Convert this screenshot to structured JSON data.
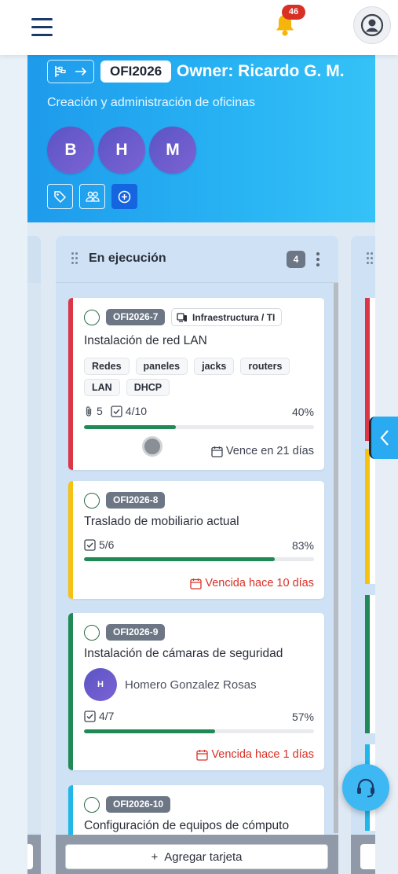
{
  "header": {
    "notification_count": "46"
  },
  "board": {
    "code": "OFI2026",
    "owner": "Owner: Ricardo G. M.",
    "subtitle": "Creación y administración de oficinas",
    "members": [
      "B",
      "H",
      "M"
    ]
  },
  "column": {
    "title": "En ejecución",
    "count": "4",
    "add_card_label": "Agregar tarjeta",
    "add_card_icon": "+"
  },
  "cards": [
    {
      "code": "OFI2026-7",
      "category": "Infraestructura / TI",
      "title": "Instalación de red LAN",
      "tags": [
        "Redes",
        "paneles",
        "jacks",
        "routers",
        "LAN",
        "DHCP"
      ],
      "attachments": "5",
      "checklist": "4/10",
      "progress_label": "40%",
      "progress": 0.4,
      "due": "Vence en 21 días",
      "accent": "#dc3545"
    },
    {
      "code": "OFI2026-8",
      "title": "Traslado de mobiliario actual",
      "checklist": "5/6",
      "progress_label": "83%",
      "progress": 0.83,
      "due": "Vencida hace 10 días",
      "accent": "#f5c211"
    },
    {
      "code": "OFI2026-9",
      "title": "Instalación de cámaras de seguridad",
      "assignee_initial": "H",
      "assignee_name": "Homero Gonzalez Rosas",
      "checklist": "4/7",
      "progress_label": "57%",
      "progress": 0.57,
      "due": "Vencida hace 1 días",
      "accent": "#1f8a55"
    },
    {
      "code": "OFI2026-10",
      "title": "Configuración de equipos de cómputo",
      "accent": "#1fb6e8"
    }
  ],
  "colors": {
    "hero_gradient_start": "#1e9bec",
    "hero_gradient_end": "#35c2f7",
    "progress_fill": "#1f8a55",
    "overdue": "#d93025",
    "primary_action": "#1565e0"
  },
  "icons": {
    "menu": "hamburger-icon",
    "notifications": "bell-icon",
    "profile": "user-circle-icon",
    "hierarchy": "hierarchy-icon",
    "tag": "tag-icon",
    "members": "users-icon",
    "add_member": "plus-circle-icon",
    "attachment": "paperclip-icon",
    "checklist": "checkbox-icon",
    "calendar": "calendar-icon",
    "side_panel": "chevron-left-icon",
    "help": "headset-icon"
  }
}
